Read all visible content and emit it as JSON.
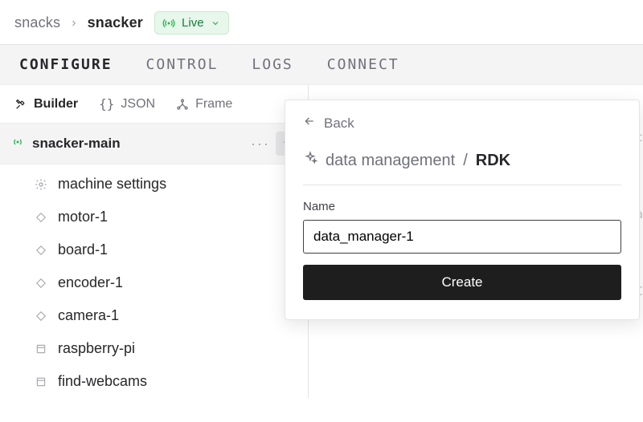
{
  "breadcrumb": {
    "parent": "snacks",
    "current": "snacker"
  },
  "status_pill": {
    "label": "Live"
  },
  "tabs": [
    {
      "label": "CONFIGURE",
      "active": true
    },
    {
      "label": "CONTROL"
    },
    {
      "label": "LOGS"
    },
    {
      "label": "CONNECT"
    }
  ],
  "modes": {
    "builder": "Builder",
    "json": "JSON",
    "frame": "Frame"
  },
  "node": {
    "name": "snacker-main",
    "children": [
      {
        "icon": "gear",
        "label": "machine settings"
      },
      {
        "icon": "diamond",
        "label": "motor-1"
      },
      {
        "icon": "diamond",
        "label": "board-1"
      },
      {
        "icon": "diamond",
        "label": "encoder-1"
      },
      {
        "icon": "diamond",
        "label": "camera-1"
      },
      {
        "icon": "package",
        "label": "raspberry-pi"
      },
      {
        "icon": "package",
        "label": "find-webcams"
      }
    ]
  },
  "panel": {
    "back": "Back",
    "title_a": "data management",
    "title_sep": "/",
    "title_b": "RDK",
    "name_label": "Name",
    "name_value": "data_manager-1",
    "create": "Create"
  },
  "bg_fragments": [
    "nc",
    "ca",
    "RC"
  ]
}
